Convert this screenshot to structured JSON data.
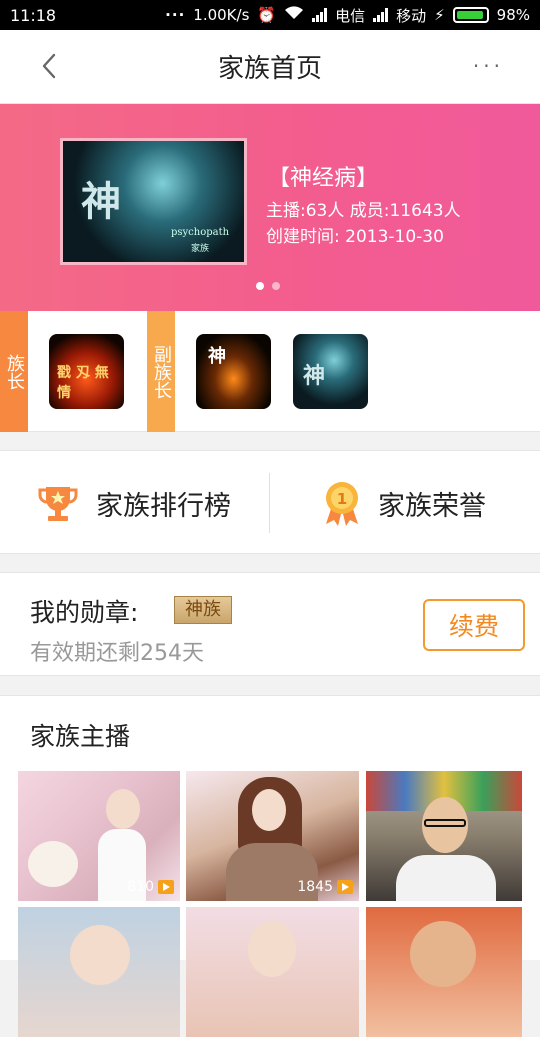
{
  "status_bar": {
    "time": "11:18",
    "network_speed": "1.00K/s",
    "carrier1": "电信",
    "carrier2": "移动",
    "battery": "98%"
  },
  "nav": {
    "title": "家族首页",
    "more": "···"
  },
  "family": {
    "name": "【神经病】",
    "stats": "主播:63人  成员:11643人",
    "created": "创建时间: 2013-10-30",
    "cover_text": {
      "big": "神",
      "sub": "psychopath",
      "sub2": "家族"
    }
  },
  "leaders": {
    "leader_tag": "族长",
    "vice_tag": "副族长",
    "avatars": [
      {
        "text": "戳 刄 無 情"
      },
      {
        "text": "神"
      },
      {
        "text": "神"
      }
    ]
  },
  "entries": {
    "ranking_label": "家族排行榜",
    "honor_label": "家族荣誉"
  },
  "medal": {
    "title": "我的勋章:",
    "badge": "神族",
    "validity": "有效期还剩254天",
    "renew_label": "续费"
  },
  "anchors": {
    "section_title": "家族主播",
    "items": [
      {
        "views": "810"
      },
      {
        "views": "1845"
      },
      {
        "views": ""
      }
    ]
  },
  "colors": {
    "accent_orange": "#f3891f",
    "banner_pink": "#f35c8f",
    "leader_tag": "#f6893f",
    "vice_tag": "#f9a94d"
  }
}
